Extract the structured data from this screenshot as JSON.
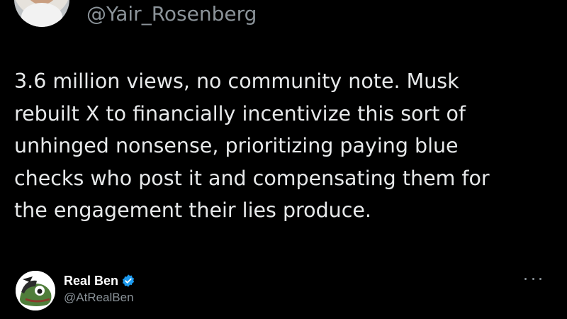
{
  "author": {
    "handle": "@Yair_Rosenberg"
  },
  "tweet": {
    "lines": [
      "3.6 million views, no community note. Musk",
      "rebuilt X to financially incentivize this sort of",
      "unhinged nonsense, prioritizing paying blue",
      "checks who post it and compensating them for",
      "the engagement their lies produce."
    ]
  },
  "quoted_post": {
    "display_name": "Real Ben",
    "handle": "@AtRealBen",
    "verified": true,
    "avatar_icon": "frog-avatar-icon",
    "more_icon": "more-options-icon"
  },
  "colors": {
    "background": "#000000",
    "text": "#e7e9ea",
    "muted": "#8b9399",
    "verified": "#1d9bf0"
  }
}
